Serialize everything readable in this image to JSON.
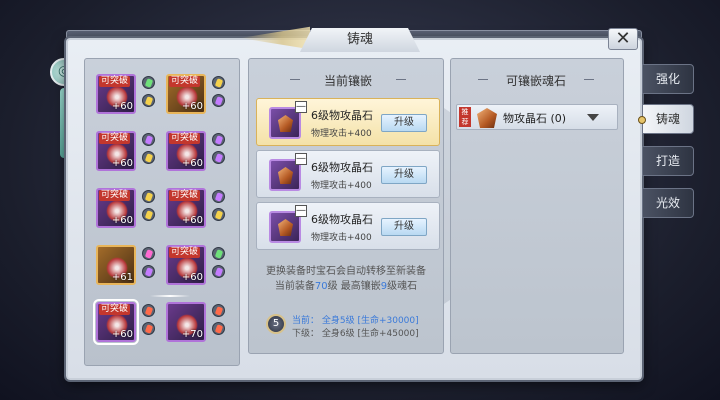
{
  "window": {
    "title": "铸魂",
    "close_label": "✕"
  },
  "inventory": {
    "items": [
      {
        "badge": "可突破",
        "level": "+60",
        "frame": "purple",
        "gems": [
          "green",
          "yellow"
        ]
      },
      {
        "badge": "可突破",
        "level": "+60",
        "frame": "gold",
        "gems": [
          "yellow",
          "purple"
        ]
      },
      {
        "badge": "可突破",
        "level": "+60",
        "frame": "purple",
        "gems": [
          "purple",
          "yellow"
        ]
      },
      {
        "badge": "可突破",
        "level": "+60",
        "frame": "purple",
        "gems": [
          "purple",
          "purple"
        ]
      },
      {
        "badge": "可突破",
        "level": "+60",
        "frame": "purple",
        "gems": [
          "yellow",
          "yellow"
        ]
      },
      {
        "badge": "可突破",
        "level": "+60",
        "frame": "purple",
        "gems": [
          "purple",
          "yellow"
        ]
      },
      {
        "badge": "",
        "level": "+61",
        "frame": "gold",
        "gems": [
          "pink",
          "purple"
        ]
      },
      {
        "badge": "可突破",
        "level": "+60",
        "frame": "purple",
        "gems": [
          "green",
          "purple"
        ]
      },
      {
        "badge": "可突破",
        "level": "+60",
        "frame": "purple",
        "gems": [
          "red",
          "red"
        ],
        "selected": true
      },
      {
        "badge": "",
        "level": "+70",
        "frame": "purple",
        "gems": [
          "red",
          "red"
        ]
      }
    ]
  },
  "current": {
    "heading": "当前镶嵌",
    "slots": [
      {
        "name": "6级物攻晶石",
        "stat": "物理攻击+400",
        "button": "升级",
        "minus": "—"
      },
      {
        "name": "6级物攻晶石",
        "stat": "物理攻击+400",
        "button": "升级",
        "minus": "—"
      },
      {
        "name": "6级物攻晶石",
        "stat": "物理攻击+400",
        "button": "升级",
        "minus": "—"
      }
    ],
    "note_line1": "更换装备时宝石会自动转移至新装备",
    "note_line2_a": "当前装备",
    "note_line2_level": "70",
    "note_line2_b": "级 最高镶嵌",
    "note_line2_max": "9",
    "note_line2_c": "级魂石",
    "set_level": "5",
    "bonus_current": "当前：  全身5级 [生命+30000]",
    "bonus_next": "下级：  全身6级 [生命+45000]"
  },
  "available": {
    "heading": "可镶嵌魂石",
    "stones": [
      {
        "badge": "推荐",
        "name": "物攻晶石 (0)"
      }
    ]
  },
  "tabs": [
    {
      "label": "强化",
      "active": false
    },
    {
      "label": "铸魂",
      "active": true
    },
    {
      "label": "打造",
      "active": false
    },
    {
      "label": "光效",
      "active": false
    }
  ],
  "colors": {
    "accent_blue": "#3b7ad9",
    "badge_red": "#c3372d",
    "selected_card": "#f4e2a8"
  },
  "icons": {
    "close": "close-icon",
    "dropdown": "caret-down-icon",
    "ornament": "jade-ornament-icon"
  }
}
